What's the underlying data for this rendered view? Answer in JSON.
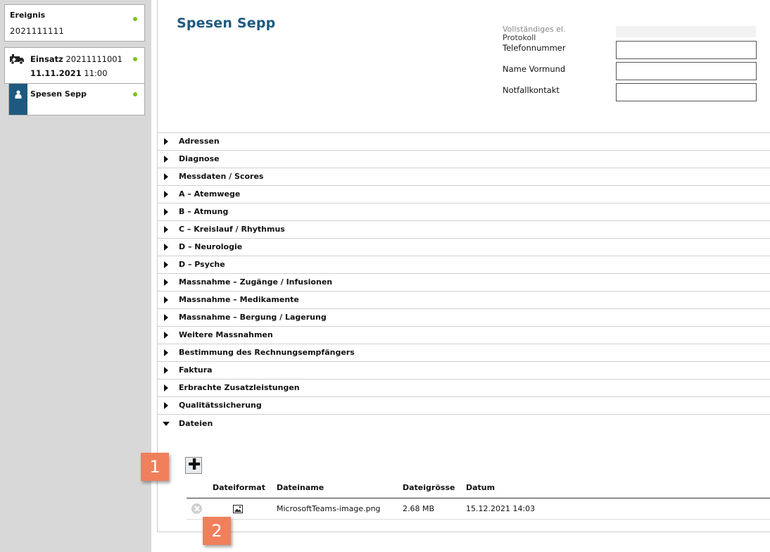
{
  "left": {
    "ereignis": {
      "title": "Ereignis",
      "number": "2021111111"
    },
    "einsatz": {
      "label": "Einsatz",
      "number": "20211111001",
      "date": "11.11.2021",
      "time": "11:00"
    },
    "patient": {
      "name": "Spesen Sepp"
    },
    "status_color": "#7cc11c"
  },
  "main": {
    "title": "Spesen Sepp",
    "cut_label_top": "Vollständiges el.",
    "cut_label_bottom": "Protokoll",
    "fields": [
      {
        "label": "Telefonnummer",
        "value": ""
      },
      {
        "label": "Name Vormund",
        "value": ""
      },
      {
        "label": "Notfallkontakt",
        "value": ""
      }
    ],
    "sections": [
      "Adressen",
      "Diagnose",
      "Messdaten / Scores",
      "A – Atemwege",
      "B – Atmung",
      "C – Kreislauf / Rhythmus",
      "D – Neurologie",
      "D – Psyche",
      "Massnahme – Zugänge / Infusionen",
      "Massnahme – Medikamente",
      "Massnahme – Bergung / Lagerung",
      "Weitere Massnahmen",
      "Bestimmung des Rechnungsempfängers",
      "Faktura",
      "Erbrachte Zusatzleistungen",
      "Qualitätssicherung",
      "Dateien"
    ],
    "files": {
      "add_icon": "plus-icon",
      "columns": [
        "Dateiformat",
        "Dateiname",
        "Dateigrösse",
        "Datum"
      ],
      "rows": [
        {
          "format_icon": "image-icon",
          "name": "MicrosoftTeams-image.png",
          "size": "2.68 MB",
          "date": "15.12.2021 14:03"
        }
      ]
    }
  },
  "callouts": [
    "1",
    "2"
  ],
  "colors": {
    "accent": "#1e5a80",
    "callout": "#f07f5c"
  }
}
